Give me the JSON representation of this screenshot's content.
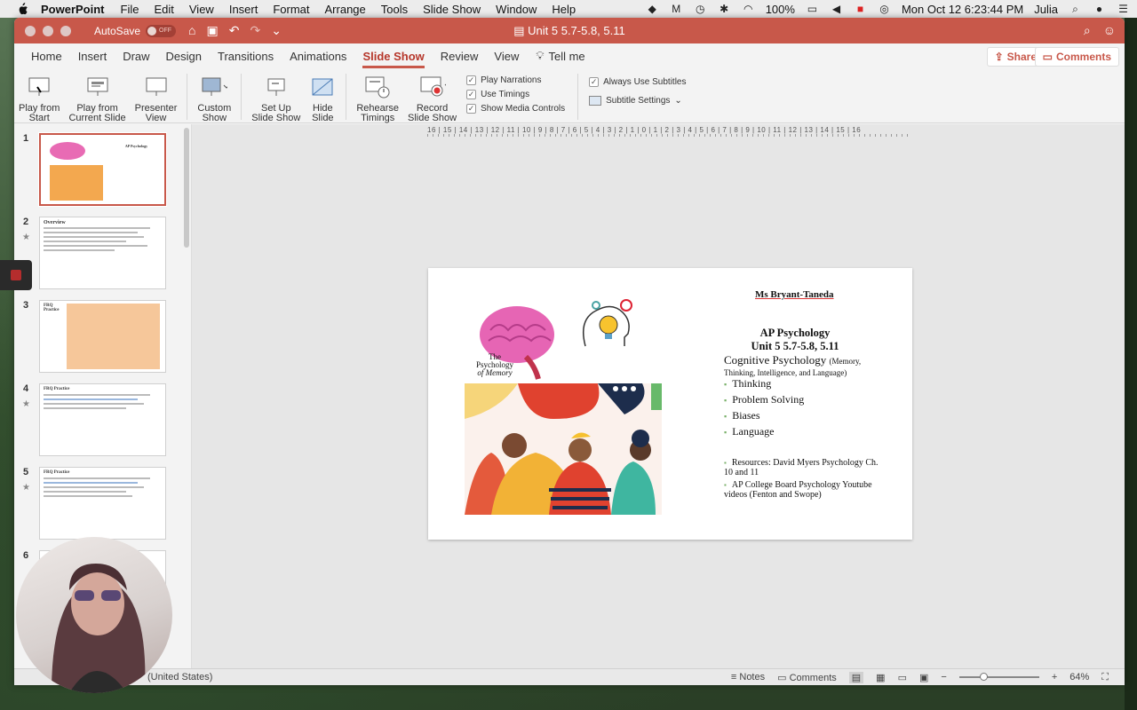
{
  "menubar": {
    "app_name": "PowerPoint",
    "items": [
      "File",
      "Edit",
      "View",
      "Insert",
      "Format",
      "Arrange",
      "Tools",
      "Slide Show",
      "Window",
      "Help"
    ],
    "battery": "100%",
    "datetime": "Mon Oct 12  6:23:44 PM",
    "user": "Julia"
  },
  "titlebar": {
    "autosave_label": "AutoSave",
    "autosave_state": "OFF",
    "doc_title": "Unit 5 5.7-5.8, 5.11"
  },
  "tabs": {
    "items": [
      "Home",
      "Insert",
      "Draw",
      "Design",
      "Transitions",
      "Animations",
      "Slide Show",
      "Review",
      "View"
    ],
    "active": "Slide Show",
    "tell_me": "Tell me",
    "share": "Share",
    "comments": "Comments"
  },
  "ribbon": {
    "play_from_start": [
      "Play from",
      "Start"
    ],
    "play_from_current": [
      "Play from",
      "Current Slide"
    ],
    "presenter_view": [
      "Presenter",
      "View"
    ],
    "custom_show": [
      "Custom",
      "Show"
    ],
    "set_up": [
      "Set Up",
      "Slide Show"
    ],
    "hide_slide": [
      "Hide",
      "Slide"
    ],
    "rehearse": [
      "Rehearse",
      "Timings"
    ],
    "record": [
      "Record",
      "Slide Show"
    ],
    "checks": [
      "Play Narrations",
      "Use Timings",
      "Show Media Controls"
    ],
    "always_subtitles": "Always Use Subtitles",
    "subtitle_settings": "Subtitle Settings"
  },
  "thumbnails": [
    {
      "num": "1",
      "title": "AP Psychology"
    },
    {
      "num": "2",
      "title": "Overview"
    },
    {
      "num": "3",
      "title": "FRQ Practice"
    },
    {
      "num": "4",
      "title": "FRQ Practice"
    },
    {
      "num": "5",
      "title": "FRQ Practice"
    },
    {
      "num": "6",
      "title": ""
    }
  ],
  "slide": {
    "author": "Ms Bryant-Taneda",
    "course_line1": "AP Psychology",
    "course_line2": "Unit 5 5.7-5.8, 5.11",
    "topic": "Cognitive Psychology",
    "topic_sub": "(Memory, Thinking, Intelligence, and Language)",
    "bullets": [
      "Thinking",
      "Problem Solving",
      "Biases",
      "Language"
    ],
    "resource1": "Resources: David Myers Psychology Ch. 10 and 11",
    "resource2": "AP College Board Psychology Youtube videos (Fenton and Swope)",
    "brain_label_1": "The",
    "brain_label_2": "Psychology",
    "brain_label_3": "of Memory"
  },
  "ruler": {
    "h_labels": "16 | 15 | 14 | 13 | 12 | 11 | 10 | 9 | 8 | 7 | 6 | 5 | 4 | 3 | 2 | 1 | 0 | 1 | 2 | 3 | 4 | 5 | 6 | 7 | 8 | 9 | 10 | 11 | 12 | 13 | 14 | 15 | 16"
  },
  "statusbar": {
    "language": "(United States)",
    "notes": "Notes",
    "comments": "Comments",
    "zoom": "64%",
    "zoom_level_fraction": 0.3
  },
  "colors": {
    "accent": "#c8584a",
    "bullet": "#7ab06a"
  }
}
